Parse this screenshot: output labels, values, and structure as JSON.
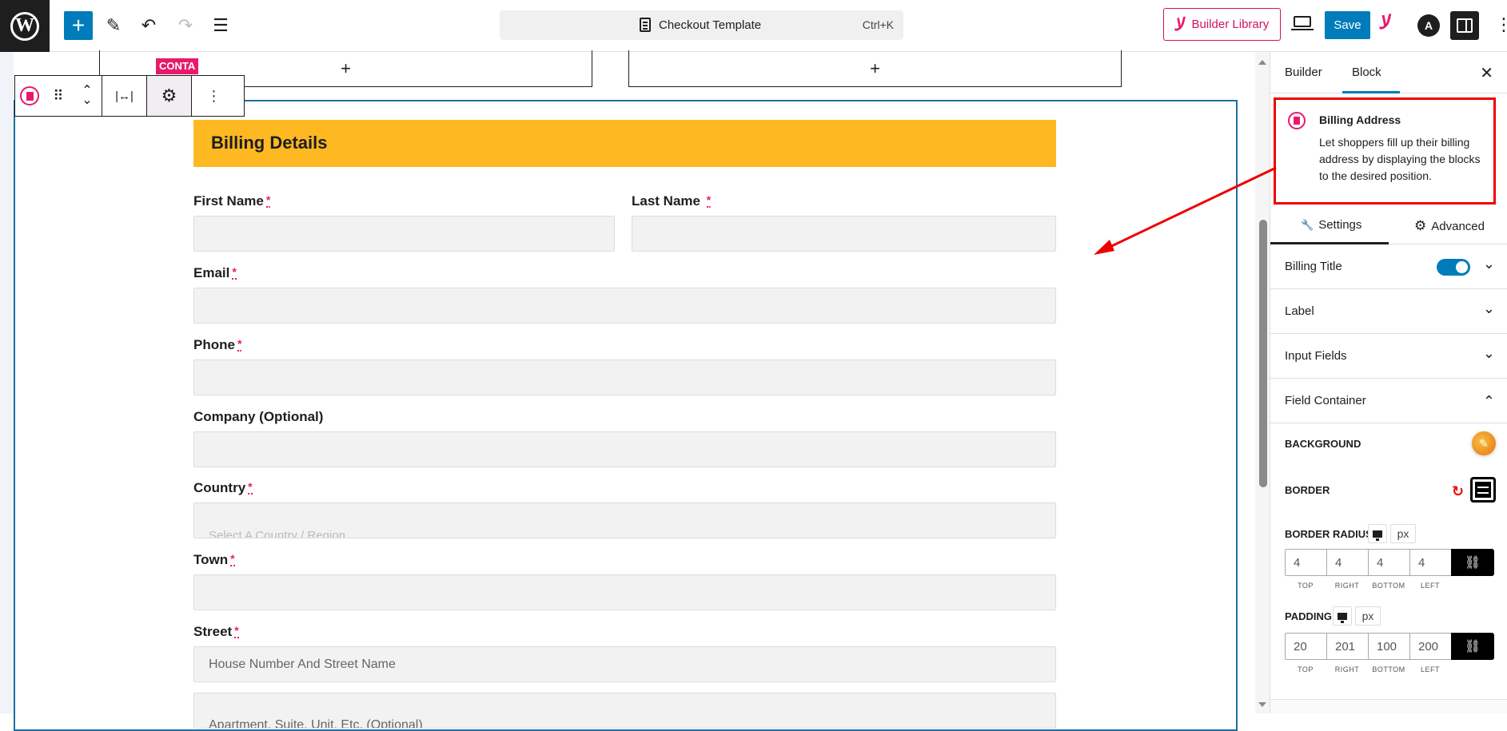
{
  "topbar": {
    "document_title": "Checkout Template",
    "shortcut": "Ctrl+K",
    "builder_library_label": "Builder Library",
    "save_label": "Save",
    "icons": {
      "wp_logo": "W",
      "add": "+",
      "edit": "✎",
      "undo": "↶",
      "redo": "↷",
      "list_view": "☰",
      "astra": "A",
      "more": "⋮"
    }
  },
  "canvas": {
    "column_add_symbol": "+",
    "container_tag": "CONTA",
    "block_toolbar": {
      "drag": "⠿",
      "move_up": "⌃",
      "move_down": "⌄",
      "width": "|↔|",
      "settings": "⚙",
      "more": "⋮"
    },
    "form": {
      "title": "Billing Details",
      "required_marker": "*",
      "fields": [
        {
          "label": "First Name",
          "required": true,
          "placeholder": ""
        },
        {
          "label": "Last Name",
          "required": true,
          "placeholder": ""
        },
        {
          "label": "Email",
          "required": true,
          "placeholder": ""
        },
        {
          "label": "Phone",
          "required": true,
          "placeholder": ""
        },
        {
          "label": "Company (Optional)",
          "required": false,
          "placeholder": ""
        },
        {
          "label": "Country",
          "required": true,
          "value": "Select A Country / Region"
        },
        {
          "label": "Town",
          "required": true,
          "placeholder": ""
        },
        {
          "label": "Street",
          "required": true,
          "placeholder": "House Number And Street Name"
        },
        {
          "label": "",
          "required": false,
          "placeholder": "Apartment, Suite, Unit, Etc. (Optional)"
        }
      ]
    }
  },
  "panel": {
    "tabs": [
      "Builder",
      "Block"
    ],
    "active_tab": "Block",
    "close": "✕",
    "block_info": {
      "title": "Billing Address",
      "description": "Let shoppers fill up their billing address by displaying the blocks to the desired position."
    },
    "subtabs": [
      {
        "label": "Settings",
        "icon": "🔧"
      },
      {
        "label": "Advanced",
        "icon": "⚙"
      }
    ],
    "active_subtab": "Settings",
    "accordions": [
      {
        "label": "Billing Title",
        "toggle": true,
        "toggle_on": true,
        "chevron": "⌄"
      },
      {
        "label": "Label",
        "chevron": "⌄"
      },
      {
        "label": "Input Fields",
        "chevron": "⌄"
      },
      {
        "label": "Field Container",
        "chevron": "⌃",
        "expanded": true
      }
    ],
    "field_container": {
      "background_label": "BACKGROUND",
      "border_label": "BORDER",
      "border_radius": {
        "label": "BORDER RADIUS",
        "unit": "px",
        "values": [
          "4",
          "4",
          "4",
          "4"
        ],
        "sides": [
          "TOP",
          "RIGHT",
          "BOTTOM",
          "LEFT"
        ]
      },
      "padding": {
        "label": "PADDING",
        "unit": "px",
        "values": [
          "20",
          "201",
          "100",
          "200"
        ],
        "sides": [
          "TOP",
          "RIGHT",
          "BOTTOM",
          "LEFT"
        ]
      },
      "reset_icon": "↻",
      "link_icon": "⛓"
    }
  },
  "colors": {
    "accent": "#007cba",
    "brand_pink": "#e8196b",
    "header_yellow": "#fdb822",
    "annotation_red": "#e00000"
  }
}
